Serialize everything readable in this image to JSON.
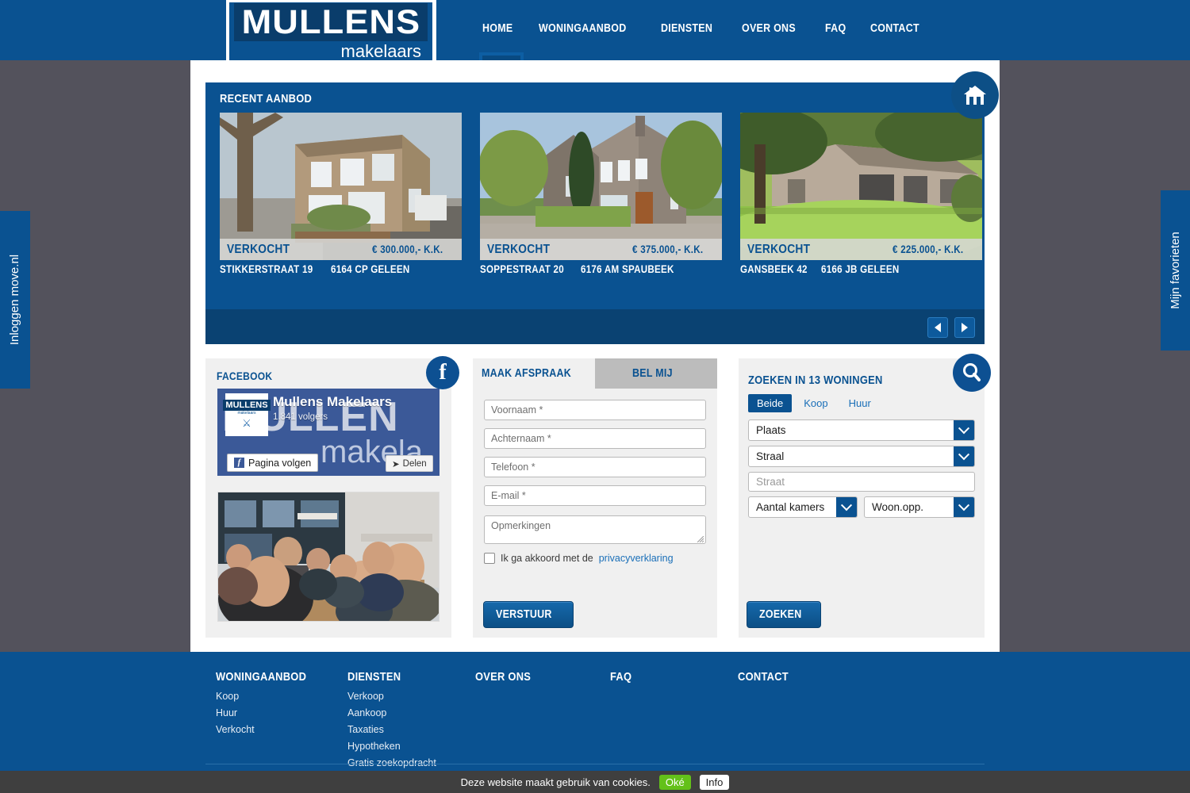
{
  "brand": {
    "name": "MULLENS",
    "tagline": "makelaars"
  },
  "nav": {
    "items": [
      {
        "label": "HOME"
      },
      {
        "label": "WONINGAANBOD"
      },
      {
        "label": "DIENSTEN"
      },
      {
        "label": "OVER ONS"
      },
      {
        "label": "FAQ"
      },
      {
        "label": "CONTACT"
      }
    ]
  },
  "side_tabs": {
    "left": "Inloggen move.nl",
    "right": "Mijn favorieten"
  },
  "recent": {
    "title": "RECENT AANBOD",
    "listings": [
      {
        "status": "VERKOCHT",
        "price": "€ 300.000,- K.K.",
        "street": "STIKKERSTRAAT 19",
        "city": "6164 CP GELEEN"
      },
      {
        "status": "VERKOCHT",
        "price": "€ 375.000,- K.K.",
        "street": "SOPPESTRAAT 20",
        "city": "6176 AM SPAUBEEK"
      },
      {
        "status": "VERKOCHT",
        "price": "€ 225.000,- K.K.",
        "street": "GANSBEEK 42",
        "city": "6166 JB GELEEN"
      }
    ],
    "prev_icon": "arrow-left-icon",
    "next_icon": "arrow-right-icon",
    "badge_icon": "house-icon"
  },
  "facebook": {
    "title": "FACEBOOK",
    "icon": "facebook-icon",
    "page_name": "Mullens Makelaars",
    "followers": "1.841 volgers",
    "follow_label": "Pagina volgen",
    "share_label": "Delen",
    "cover_word": "MULLEN",
    "cover_word2": "makela",
    "avatar_text": "MULLENS",
    "avatar_sub": "makelaars"
  },
  "form": {
    "tab_active": "MAAK AFSPRAAK",
    "tab_inactive": "BEL MIJ",
    "fields": [
      {
        "placeholder": "Voornaam *"
      },
      {
        "placeholder": "Achternaam *"
      },
      {
        "placeholder": "Telefoon *"
      },
      {
        "placeholder": "E-mail *"
      }
    ],
    "textarea_placeholder": "Opmerkingen",
    "consent_text": "Ik ga akkoord met de",
    "consent_link": "privacyverklaring",
    "submit_label": "VERSTUUR"
  },
  "search": {
    "title": "ZOEKEN IN 13 WONINGEN",
    "icon": "search-icon",
    "segments": [
      {
        "label": "Beide",
        "selected": true
      },
      {
        "label": "Koop",
        "selected": false
      },
      {
        "label": "Huur",
        "selected": false
      }
    ],
    "plaats": "Plaats",
    "straal": "Straal",
    "straat_placeholder": "Straat",
    "kamers": "Aantal kamers",
    "woonopp": "Woon.opp.",
    "submit_label": "ZOEKEN"
  },
  "footer": {
    "columns": [
      {
        "heading": "WONINGAANBOD",
        "links": [
          "Koop",
          "Huur",
          "Verkocht"
        ]
      },
      {
        "heading": "DIENSTEN",
        "links": [
          "Verkoop",
          "Aankoop",
          "Taxaties",
          "Hypotheken",
          "Gratis zoekopdracht"
        ]
      },
      {
        "heading": "OVER ONS",
        "links": []
      },
      {
        "heading": "FAQ",
        "links": []
      },
      {
        "heading": "CONTACT",
        "links": []
      }
    ]
  },
  "cookie": {
    "message": "Deze website maakt gebruik van cookies.",
    "ok": "Oké",
    "info": "Info"
  },
  "colors": {
    "brand_blue": "#0a5291",
    "dark_blue": "#0a4272",
    "page_bg": "#53525c",
    "panel_bg": "#f0f0f0",
    "cookie_ok": "#63c119"
  }
}
